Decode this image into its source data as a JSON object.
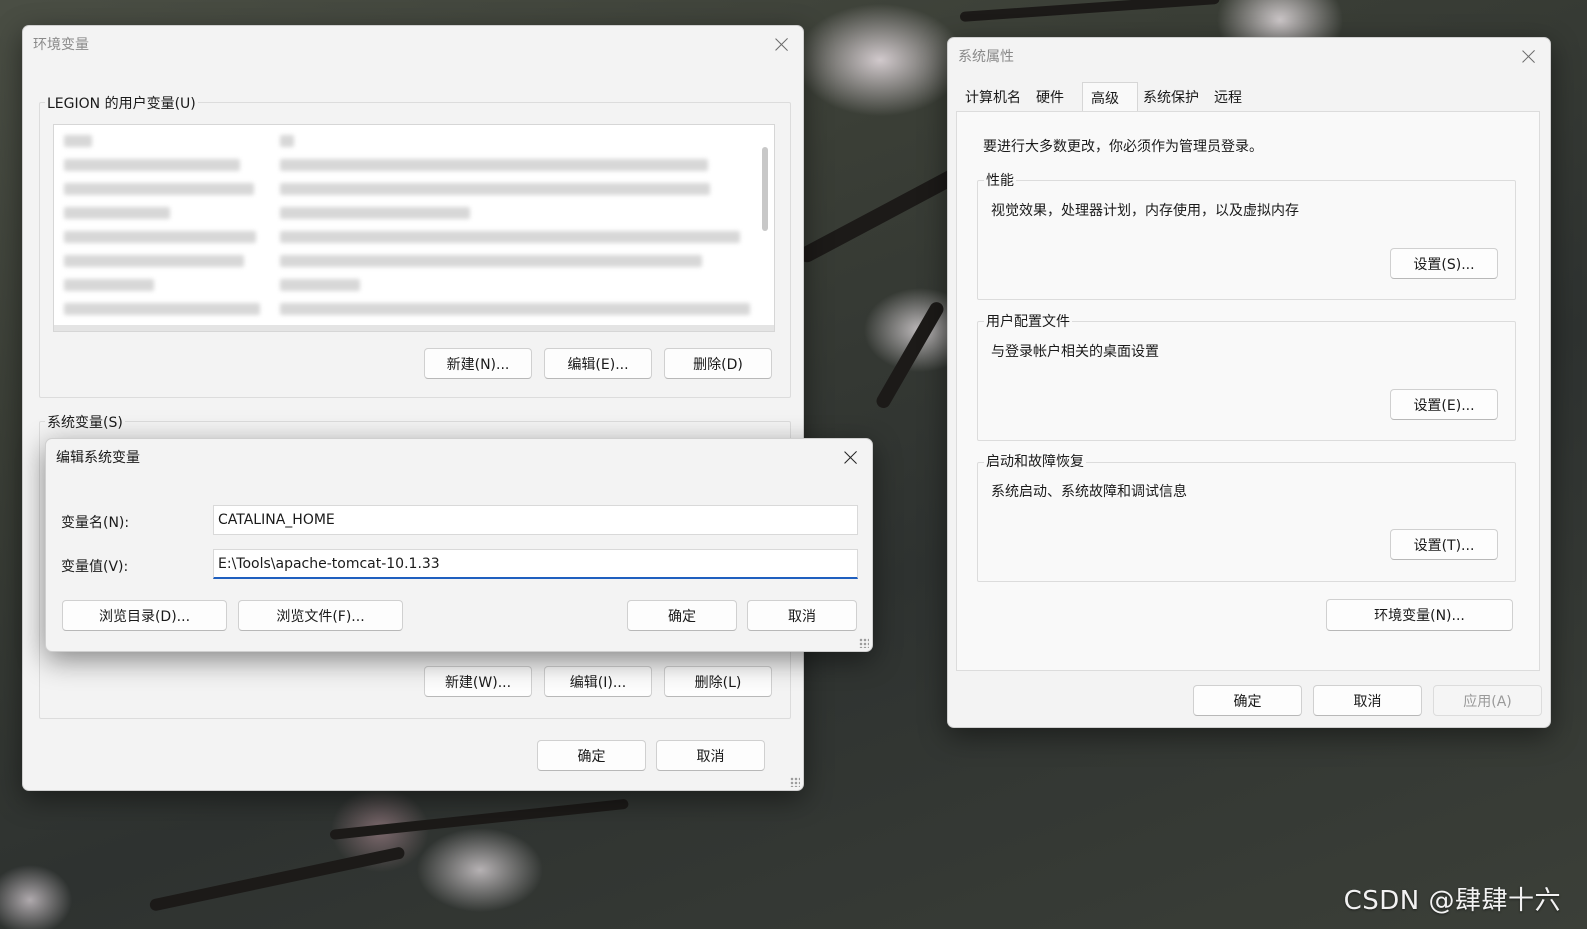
{
  "env_window": {
    "title": "环境变量",
    "user_vars_label": "LEGION 的用户变量(U)",
    "user_buttons": {
      "new": "新建(N)...",
      "edit": "编辑(E)...",
      "delete": "删除(D)"
    },
    "system_vars_label": "系统变量(S)",
    "system_buttons": {
      "new": "新建(W)...",
      "edit": "编辑(I)...",
      "delete": "删除(L)"
    },
    "ok": "确定",
    "cancel": "取消"
  },
  "edit_dialog": {
    "title": "编辑系统变量",
    "name_label": "变量名(N):",
    "name_value": "CATALINA_HOME",
    "value_label": "变量值(V):",
    "value_value": "E:\\Tools\\apache-tomcat-10.1.33",
    "browse_dir": "浏览目录(D)...",
    "browse_file": "浏览文件(F)...",
    "ok": "确定",
    "cancel": "取消"
  },
  "sys_props": {
    "title": "系统属性",
    "tabs": [
      "计算机名",
      "硬件",
      "高级",
      "系统保护",
      "远程"
    ],
    "active_tab": "高级",
    "admin_note": "要进行大多数更改，你必须作为管理员登录。",
    "performance": {
      "label": "性能",
      "desc": "视觉效果，处理器计划，内存使用，以及虚拟内存",
      "button": "设置(S)..."
    },
    "profile": {
      "label": "用户配置文件",
      "desc": "与登录帐户相关的桌面设置",
      "button": "设置(E)..."
    },
    "startup": {
      "label": "启动和故障恢复",
      "desc": "系统启动、系统故障和调试信息",
      "button": "设置(T)..."
    },
    "env_button": "环境变量(N)...",
    "ok": "确定",
    "cancel": "取消",
    "apply": "应用(A)"
  },
  "watermark": "CSDN @肆肆十六"
}
